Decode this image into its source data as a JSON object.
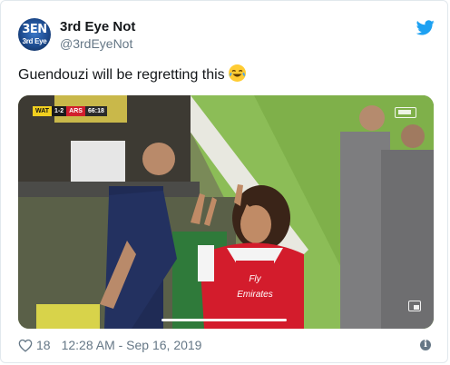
{
  "author": {
    "display_name": "3rd Eye Not",
    "handle": "@3rdEyeNot",
    "avatar_text_top": "3EN",
    "avatar_text_bottom": "3rd Eye"
  },
  "tweet": {
    "text": "Guendouzi will be regretting this",
    "emoji": "face-with-tears-of-joy"
  },
  "media": {
    "type": "video",
    "scorebug": {
      "home": "WAT",
      "score": "1-2",
      "away": "ARS",
      "clock": "66:18"
    },
    "shirt_sponsor": "Fly Emirates"
  },
  "footer": {
    "like_count": "18",
    "timestamp": "12:28 AM - Sep 16, 2019"
  },
  "icons": {
    "platform": "twitter-bird-icon",
    "like": "heart-icon",
    "info": "info-icon"
  },
  "colors": {
    "twitter_blue": "#1da1f2",
    "text_primary": "#14171a",
    "text_secondary": "#657786",
    "arsenal_red": "#d11e2d",
    "watford_yellow": "#f1cf1f"
  }
}
